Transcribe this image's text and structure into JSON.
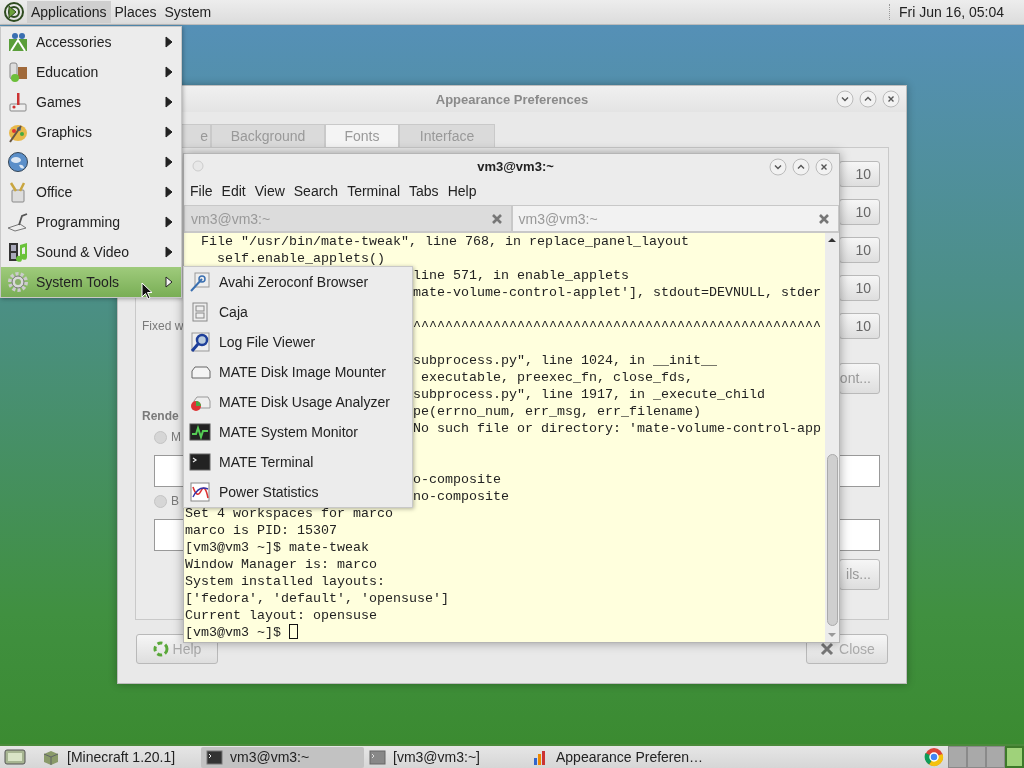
{
  "top_panel": {
    "menus": [
      {
        "label": "Applications",
        "selected": true
      },
      {
        "label": "Places",
        "selected": false
      },
      {
        "label": "System",
        "selected": false
      }
    ],
    "clock": "Fri Jun 16, 05:04"
  },
  "appearance_window": {
    "title": "Appearance Preferences",
    "tabs": [
      {
        "label": "e",
        "selected": false
      },
      {
        "label": "Background",
        "selected": false
      },
      {
        "label": "Fonts",
        "selected": true
      },
      {
        "label": "Interface",
        "selected": false
      }
    ],
    "size_buttons": [
      "10",
      "10",
      "10",
      "10",
      "10"
    ],
    "fixed_width_label": "Fixed w",
    "font_button": "ont...",
    "rendering_label": "Rende",
    "rendering_options": [
      {
        "label": "M",
        "selected": false
      },
      {
        "label": "B",
        "selected": false
      }
    ],
    "details_button": "ils...",
    "help_button": "Help",
    "close_button": "Close"
  },
  "terminal_window": {
    "title": "vm3@vm3:~",
    "menu": [
      "File",
      "Edit",
      "View",
      "Search",
      "Terminal",
      "Tabs",
      "Help"
    ],
    "tabs": [
      {
        "label": "vm3@vm3:~",
        "selected": false
      },
      {
        "label": "vm3@vm3:~",
        "selected": true
      }
    ],
    "lines": [
      {
        "kind": "full",
        "text": "  File \"/usr/bin/mate-tweak\", line 768, in replace_panel_layout"
      },
      {
        "kind": "full",
        "text": "    self.enable_applets()"
      },
      {
        "kind": "partial",
        "text": "line 571, in enable_applets"
      },
      {
        "kind": "partial",
        "text": "mate-volume-control-applet'], stdout=DEVNULL, stder"
      },
      {
        "kind": "hidden"
      },
      {
        "kind": "partial",
        "text": "^^^^^^^^^^^^^^^^^^^^^^^^^^^^^^^^^^^^^^^^^^^^^^^^^^^"
      },
      {
        "kind": "hidden"
      },
      {
        "kind": "partial",
        "text": "subprocess.py\", line 1024, in __init__"
      },
      {
        "kind": "partial",
        "text": " executable, preexec_fn, close_fds,"
      },
      {
        "kind": "partial",
        "text": "subprocess.py\", line 1917, in _execute_child"
      },
      {
        "kind": "partial",
        "text": "pe(errno_num, err_msg, err_filename)"
      },
      {
        "kind": "partial",
        "text": "No such file or directory: 'mate-volume-control-app"
      },
      {
        "kind": "hidden"
      },
      {
        "kind": "hidden"
      },
      {
        "kind": "partial",
        "text": "o-composite"
      },
      {
        "kind": "partial",
        "text": "no-composite"
      },
      {
        "kind": "full",
        "text": "Set 4 workspaces for marco"
      },
      {
        "kind": "full",
        "text": "marco is PID: 15307"
      },
      {
        "kind": "full",
        "text": "[vm3@vm3 ~]$ mate-tweak"
      },
      {
        "kind": "full",
        "text": "Window Manager is: marco"
      },
      {
        "kind": "full",
        "text": "System installed layouts:"
      },
      {
        "kind": "full",
        "text": "['fedora', 'default', 'opensuse']"
      },
      {
        "kind": "full",
        "text": "Current layout: opensuse"
      },
      {
        "kind": "prompt",
        "text": "[vm3@vm3 ~]$"
      }
    ]
  },
  "applications_menu": {
    "items": [
      {
        "label": "Accessories",
        "selected": false
      },
      {
        "label": "Education",
        "selected": false
      },
      {
        "label": "Games",
        "selected": false
      },
      {
        "label": "Graphics",
        "selected": false
      },
      {
        "label": "Internet",
        "selected": false
      },
      {
        "label": "Office",
        "selected": false
      },
      {
        "label": "Programming",
        "selected": false
      },
      {
        "label": "Sound & Video",
        "selected": false
      },
      {
        "label": "System Tools",
        "selected": true
      }
    ]
  },
  "system_tools_submenu": {
    "items": [
      "Avahi Zeroconf Browser",
      "Caja",
      "Log File Viewer",
      "MATE Disk Image Mounter",
      "MATE Disk Usage Analyzer",
      "MATE System Monitor",
      "MATE Terminal",
      "Power Statistics"
    ]
  },
  "taskbar": {
    "windows": [
      {
        "label": "[Minecraft 1.20.1]",
        "selected": false
      },
      {
        "label": "vm3@vm3:~",
        "selected": true
      },
      {
        "label": "[vm3@vm3:~]",
        "selected": false
      },
      {
        "label": "Appearance Preferen…",
        "selected": false
      }
    ],
    "workspaces": [
      {
        "selected": false
      },
      {
        "selected": false
      },
      {
        "selected": false
      },
      {
        "selected": true
      }
    ]
  }
}
